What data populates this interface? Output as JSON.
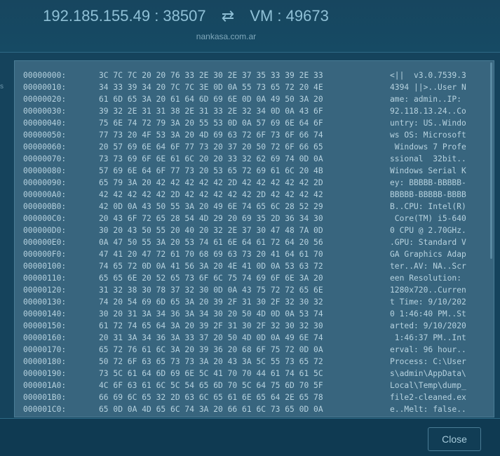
{
  "header": {
    "ip_port": "192.185.155.49 : 38507",
    "vm_label": "VM : 49673",
    "hostname": "nankasa.com.ar",
    "swap_icon": "swap-arrows-icon"
  },
  "side": {
    "edge_char": "s"
  },
  "hexdump": {
    "rows": [
      {
        "offset": "00000000:",
        "hex": "3C 7C 7C 20 20 76 33 2E 30 2E 37 35 33 39 2E 33",
        "ascii": "<||  v3.0.7539.3"
      },
      {
        "offset": "00000010:",
        "hex": "34 33 39 34 20 7C 7C 3E 0D 0A 55 73 65 72 20 4E",
        "ascii": "4394 ||>..User N"
      },
      {
        "offset": "00000020:",
        "hex": "61 6D 65 3A 20 61 64 6D 69 6E 0D 0A 49 50 3A 20",
        "ascii": "ame: admin..IP: "
      },
      {
        "offset": "00000030:",
        "hex": "39 32 2E 31 31 38 2E 31 33 2E 32 34 0D 0A 43 6F",
        "ascii": "92.118.13.24..Co"
      },
      {
        "offset": "00000040:",
        "hex": "75 6E 74 72 79 3A 20 55 53 0D 0A 57 69 6E 64 6F",
        "ascii": "untry: US..Windo"
      },
      {
        "offset": "00000050:",
        "hex": "77 73 20 4F 53 3A 20 4D 69 63 72 6F 73 6F 66 74",
        "ascii": "ws OS: Microsoft"
      },
      {
        "offset": "00000060:",
        "hex": "20 57 69 6E 64 6F 77 73 20 37 20 50 72 6F 66 65",
        "ascii": " Windows 7 Profe"
      },
      {
        "offset": "00000070:",
        "hex": "73 73 69 6F 6E 61 6C 20 20 33 32 62 69 74 0D 0A",
        "ascii": "ssional  32bit.."
      },
      {
        "offset": "00000080:",
        "hex": "57 69 6E 64 6F 77 73 20 53 65 72 69 61 6C 20 4B",
        "ascii": "Windows Serial K"
      },
      {
        "offset": "00000090:",
        "hex": "65 79 3A 20 42 42 42 42 42 2D 42 42 42 42 42 2D",
        "ascii": "ey: BBBBB-BBBBB-"
      },
      {
        "offset": "000000A0:",
        "hex": "42 42 42 42 42 2D 42 42 42 42 42 2D 42 42 42 42",
        "ascii": "BBBBB-BBBBB-BBBB"
      },
      {
        "offset": "000000B0:",
        "hex": "42 0D 0A 43 50 55 3A 20 49 6E 74 65 6C 28 52 29",
        "ascii": "B..CPU: Intel(R)"
      },
      {
        "offset": "000000C0:",
        "hex": "20 43 6F 72 65 28 54 4D 29 20 69 35 2D 36 34 30",
        "ascii": " Core(TM) i5-640"
      },
      {
        "offset": "000000D0:",
        "hex": "30 20 43 50 55 20 40 20 32 2E 37 30 47 48 7A 0D",
        "ascii": "0 CPU @ 2.70GHz."
      },
      {
        "offset": "000000E0:",
        "hex": "0A 47 50 55 3A 20 53 74 61 6E 64 61 72 64 20 56",
        "ascii": ".GPU: Standard V"
      },
      {
        "offset": "000000F0:",
        "hex": "47 41 20 47 72 61 70 68 69 63 73 20 41 64 61 70",
        "ascii": "GA Graphics Adap"
      },
      {
        "offset": "00000100:",
        "hex": "74 65 72 0D 0A 41 56 3A 20 4E 41 0D 0A 53 63 72",
        "ascii": "ter..AV: NA..Scr"
      },
      {
        "offset": "00000110:",
        "hex": "65 65 6E 20 52 65 73 6F 6C 75 74 69 6F 6E 3A 20",
        "ascii": "een Resolution: "
      },
      {
        "offset": "00000120:",
        "hex": "31 32 38 30 78 37 32 30 0D 0A 43 75 72 72 65 6E",
        "ascii": "1280x720..Curren"
      },
      {
        "offset": "00000130:",
        "hex": "74 20 54 69 6D 65 3A 20 39 2F 31 30 2F 32 30 32",
        "ascii": "t Time: 9/10/202"
      },
      {
        "offset": "00000140:",
        "hex": "30 20 31 3A 34 36 3A 34 30 20 50 4D 0D 0A 53 74",
        "ascii": "0 1:46:40 PM..St"
      },
      {
        "offset": "00000150:",
        "hex": "61 72 74 65 64 3A 20 39 2F 31 30 2F 32 30 32 30",
        "ascii": "arted: 9/10/2020"
      },
      {
        "offset": "00000160:",
        "hex": "20 31 3A 34 36 3A 33 37 20 50 4D 0D 0A 49 6E 74",
        "ascii": " 1:46:37 PM..Int"
      },
      {
        "offset": "00000170:",
        "hex": "65 72 76 61 6C 3A 20 39 36 20 68 6F 75 72 0D 0A",
        "ascii": "erval: 96 hour.."
      },
      {
        "offset": "00000180:",
        "hex": "50 72 6F 63 65 73 73 3A 20 43 3A 5C 55 73 65 72",
        "ascii": "Process: C:\\User"
      },
      {
        "offset": "00000190:",
        "hex": "73 5C 61 64 6D 69 6E 5C 41 70 70 44 61 74 61 5C",
        "ascii": "s\\admin\\AppData\\"
      },
      {
        "offset": "000001A0:",
        "hex": "4C 6F 63 61 6C 5C 54 65 6D 70 5C 64 75 6D 70 5F",
        "ascii": "Local\\Temp\\dump_"
      },
      {
        "offset": "000001B0:",
        "hex": "66 69 6C 65 32 2D 63 6C 65 61 6E 65 64 2E 65 78",
        "ascii": "file2-cleaned.ex"
      },
      {
        "offset": "000001C0:",
        "hex": "65 0D 0A 4D 65 6C 74 3A 20 66 61 6C 73 65 0D 0A",
        "ascii": "e..Melt: false.."
      }
    ]
  },
  "footer": {
    "close_label": "Close"
  }
}
